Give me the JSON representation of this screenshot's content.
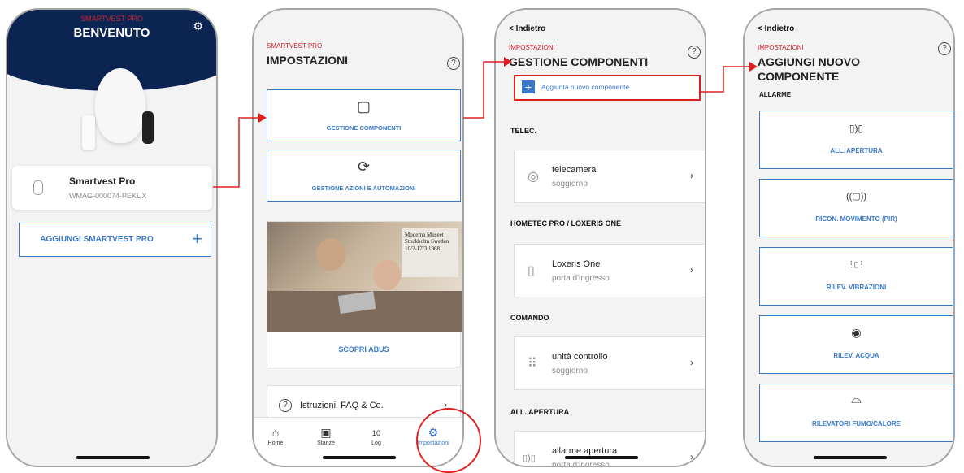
{
  "phone1": {
    "brand": "SMARTVEST PRO",
    "title": "BENVENUTO",
    "gear_icon": "gear-icon",
    "device": {
      "name": "Smartvest Pro",
      "id": "WMAG-000074-PEKUX"
    },
    "add_button": {
      "label": "AGGIUNGI SMARTVEST PRO",
      "plus": "+"
    }
  },
  "phone2": {
    "brand": "SMARTVEST PRO",
    "title": "IMPOSTAZIONI",
    "help": "?",
    "tiles": [
      {
        "label": "GESTIONE COMPONENTI",
        "icon": "tablet-icon"
      },
      {
        "label": "GESTIONE AZIONI E AUTOMAZIONI",
        "icon": "sync-gear-icon"
      }
    ],
    "promo": {
      "poster_text": "Moderna Museet Stockholm Sweden 10/2-17/3 1968",
      "link": "SCOPRI ABUS"
    },
    "faq": {
      "label": "Istruzioni, FAQ & Co.",
      "q": "?"
    },
    "tabs": [
      {
        "label": "Home",
        "icon": "home-icon",
        "glyph": "⌂"
      },
      {
        "label": "Stanze",
        "icon": "room-icon",
        "glyph": "▣"
      },
      {
        "label": "Log",
        "icon": "calendar-icon",
        "glyph": "10"
      },
      {
        "label": "Impostazioni",
        "icon": "settings-icon",
        "glyph": "⚙"
      }
    ],
    "active_tab": "Impostazioni"
  },
  "phone3": {
    "back": "< Indietro",
    "brand": "IMPOSTAZIONI",
    "title": "GESTIONE COMPONENTI",
    "help": "?",
    "add_component": {
      "plus": "+",
      "label": "Aggiunta nuovo componente"
    },
    "sections": [
      {
        "header": "TELEC.",
        "items": [
          {
            "name": "telecamera",
            "sub": "soggiorno",
            "icon": "camera-icon",
            "glyph": "◎"
          }
        ]
      },
      {
        "header": "HOMETEC PRO / LOXERIS ONE",
        "items": [
          {
            "name": "Loxeris One",
            "sub": "porta d'ingresso",
            "icon": "lock-icon",
            "glyph": "▯"
          }
        ]
      },
      {
        "header": "COMANDO",
        "items": [
          {
            "name": "unità controllo",
            "sub": "soggiorno",
            "icon": "keypad-icon",
            "glyph": "⠿"
          }
        ]
      },
      {
        "header": "ALL. APERTURA",
        "items": [
          {
            "name": "allarme apertura",
            "sub": "porta d'ingresso",
            "icon": "door-contact-icon",
            "glyph": "▯)▯"
          }
        ]
      }
    ]
  },
  "phone4": {
    "back": "< Indietro",
    "brand": "IMPOSTAZIONI",
    "title_line1": "AGGIUNGI NUOVO",
    "title_line2": "COMPONENTE",
    "help": "?",
    "section": "ALLARME",
    "tiles": [
      {
        "label": "ALL. APERTURA",
        "icon": "door-contact-icon",
        "glyph": "▯)▯"
      },
      {
        "label": "RICON. MOVIMENTO (PIR)",
        "icon": "motion-sensor-icon",
        "glyph": "((▢))"
      },
      {
        "label": "RILEV. VIBRAZIONI",
        "icon": "vibration-icon",
        "glyph": "⫶▯⫶"
      },
      {
        "label": "RILEV. ACQUA",
        "icon": "water-icon",
        "glyph": "◉"
      },
      {
        "label": "RILEVATORI FUMO/CALORE",
        "icon": "smoke-detector-icon",
        "glyph": "⌓"
      }
    ]
  },
  "colors": {
    "brand_red": "#d0202a",
    "navy": "#0c2452",
    "accent_blue": "#3a78c9",
    "annotation_red": "#e02020"
  }
}
